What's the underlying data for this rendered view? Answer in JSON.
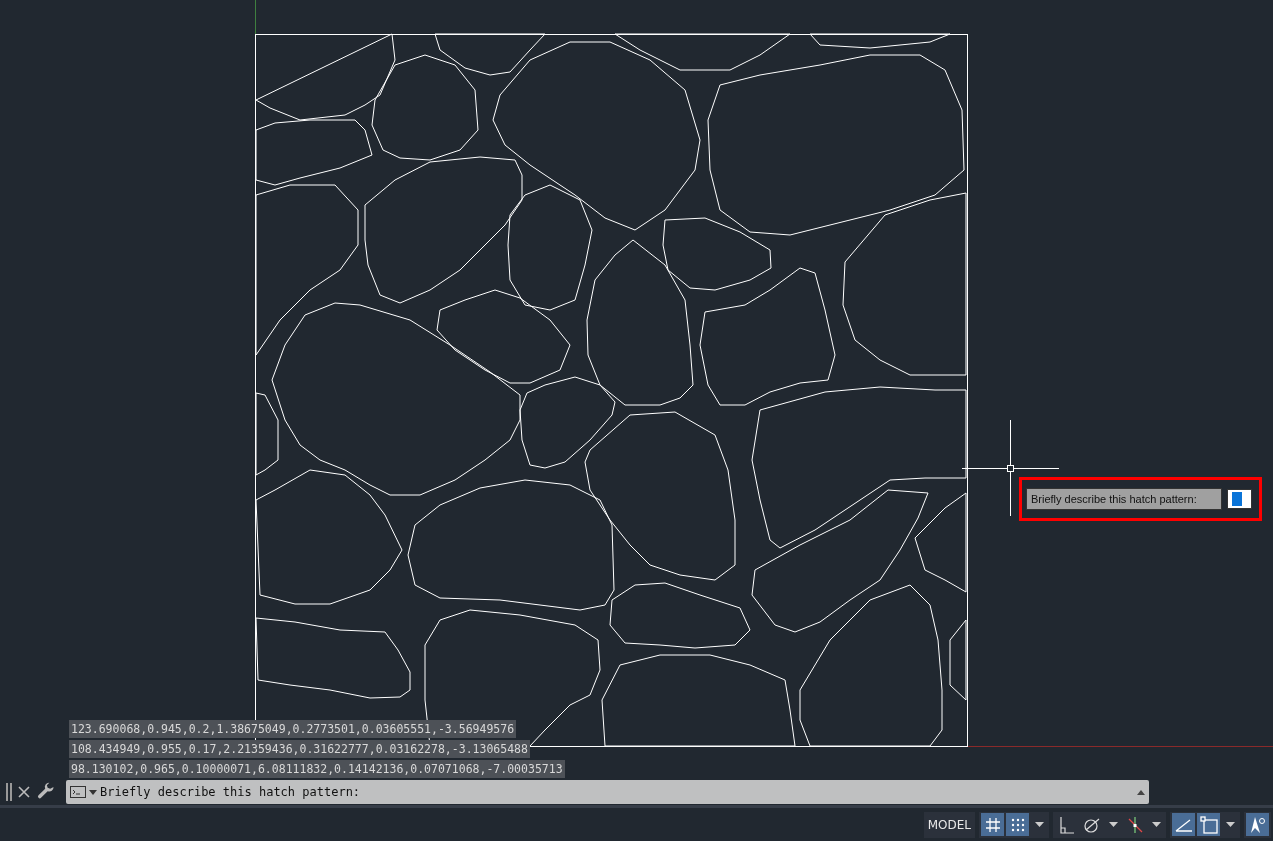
{
  "command_history": [
    "123.690068,0.945,0.2,1.38675049,0.2773501,0.03605551,-3.56949576",
    "108.434949,0.955,0.17,2.21359436,0.31622777,0.03162278,-3.13065488",
    "98.130102,0.965,0.10000071,6.08111832,0.14142136,0.07071068,-7.00035713"
  ],
  "command_line": {
    "prompt": "Briefly describe this hatch pattern:"
  },
  "dynamic_input": {
    "prompt": "Briefly describe this hatch pattern:"
  },
  "status_bar": {
    "space": "MODEL",
    "groups": [
      [
        {
          "kind": "grid",
          "on": true
        },
        {
          "kind": "snap",
          "on": true
        },
        {
          "kind": "menu",
          "on": false
        }
      ],
      [
        {
          "kind": "ortho",
          "on": false
        },
        {
          "kind": "polar",
          "on": false
        },
        {
          "kind": "menu",
          "on": false
        },
        {
          "kind": "tracking",
          "on": false
        },
        {
          "kind": "menu",
          "on": false
        }
      ],
      [
        {
          "kind": "dynamic",
          "on": true
        },
        {
          "kind": "selection",
          "on": true
        },
        {
          "kind": "menu",
          "on": false
        }
      ],
      [
        {
          "kind": "annotation",
          "on": true
        }
      ]
    ]
  }
}
